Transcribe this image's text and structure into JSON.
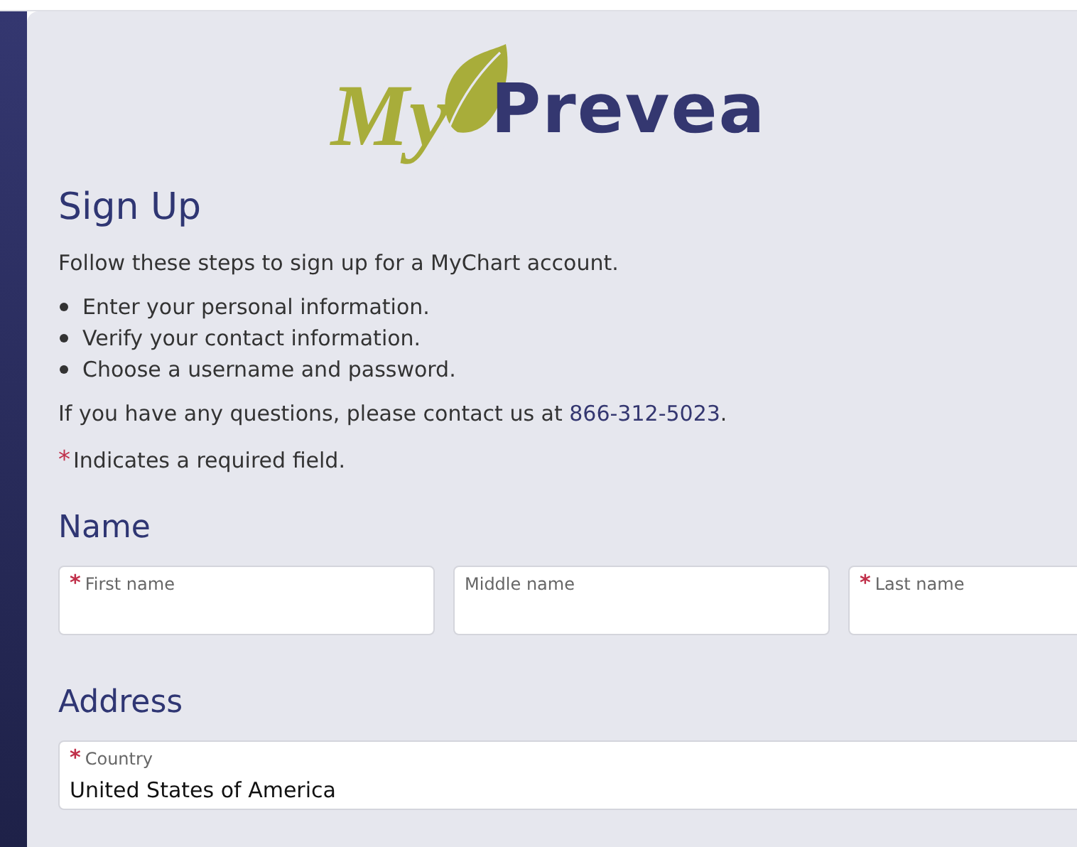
{
  "logo": {
    "first": "My",
    "second": "Prevea"
  },
  "title": "Sign Up",
  "intro": "Follow these steps to sign up for a MyChart account.",
  "steps": [
    "Enter your personal information.",
    "Verify your contact information.",
    "Choose a username and password."
  ],
  "contact": {
    "before": "If you have any questions, please contact us at",
    "phone": "866-312-5023",
    "after": "."
  },
  "required_note": {
    "mark": "*",
    "text": "Indicates a required field."
  },
  "sections": [
    {
      "heading": "Name",
      "fields": [
        {
          "label": "First name",
          "required": true
        },
        {
          "label": "Middle name",
          "required": false
        },
        {
          "label": "Last name",
          "required": true
        }
      ]
    },
    {
      "heading": "Address",
      "fields": [
        {
          "label": "Country",
          "required": true,
          "value": "United States of America"
        }
      ]
    }
  ]
}
